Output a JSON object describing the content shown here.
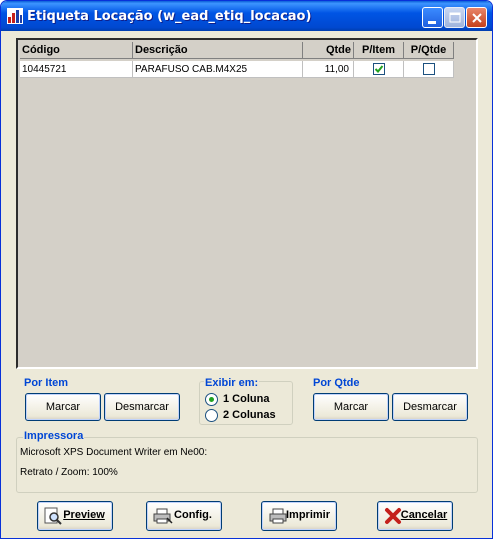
{
  "window": {
    "title": "Etiqueta Locação (w_ead_etiq_locacao)"
  },
  "grid": {
    "columns": [
      "Código",
      "Descrição",
      "Qtde",
      "P/Item",
      "P/Qtde"
    ],
    "rows": [
      {
        "codigo": "10445721",
        "descricao": "PARAFUSO CAB.M4X25",
        "qtde": "11,00",
        "p_item": true,
        "p_qtde": false
      }
    ]
  },
  "por_item": {
    "title": "Por Item",
    "marcar_label": "Marcar",
    "desmarcar_label": "Desmarcar"
  },
  "exibir": {
    "title": "Exibir em:",
    "options": [
      "1 Coluna",
      "2 Colunas"
    ],
    "selected": "1 Coluna"
  },
  "por_qtde": {
    "title": "Por Qtde",
    "marcar_label": "Marcar",
    "desmarcar_label": "Desmarcar"
  },
  "impressora": {
    "title": "Impressora",
    "printer": "Microsoft XPS Document Writer em Ne00:",
    "mode": "Retrato / Zoom: 100%"
  },
  "actions": {
    "preview_label": "Preview",
    "config_label": "Config.",
    "imprimir_label": "Imprimir",
    "cancelar_label": "Cancelar"
  },
  "icons": {
    "app": "app-icon",
    "minimize": "minimize-icon",
    "maximize": "maximize-icon",
    "close": "close-icon",
    "preview": "magnifier-icon",
    "config": "printer-config-icon",
    "imprimir": "printer-icon",
    "cancelar": "cancel-x-icon"
  },
  "colors": {
    "titlebar": "#0055e5",
    "group_title": "#0046d5",
    "face": "#ece9d8",
    "check": "#21a121",
    "cancel": "#c4201c"
  }
}
